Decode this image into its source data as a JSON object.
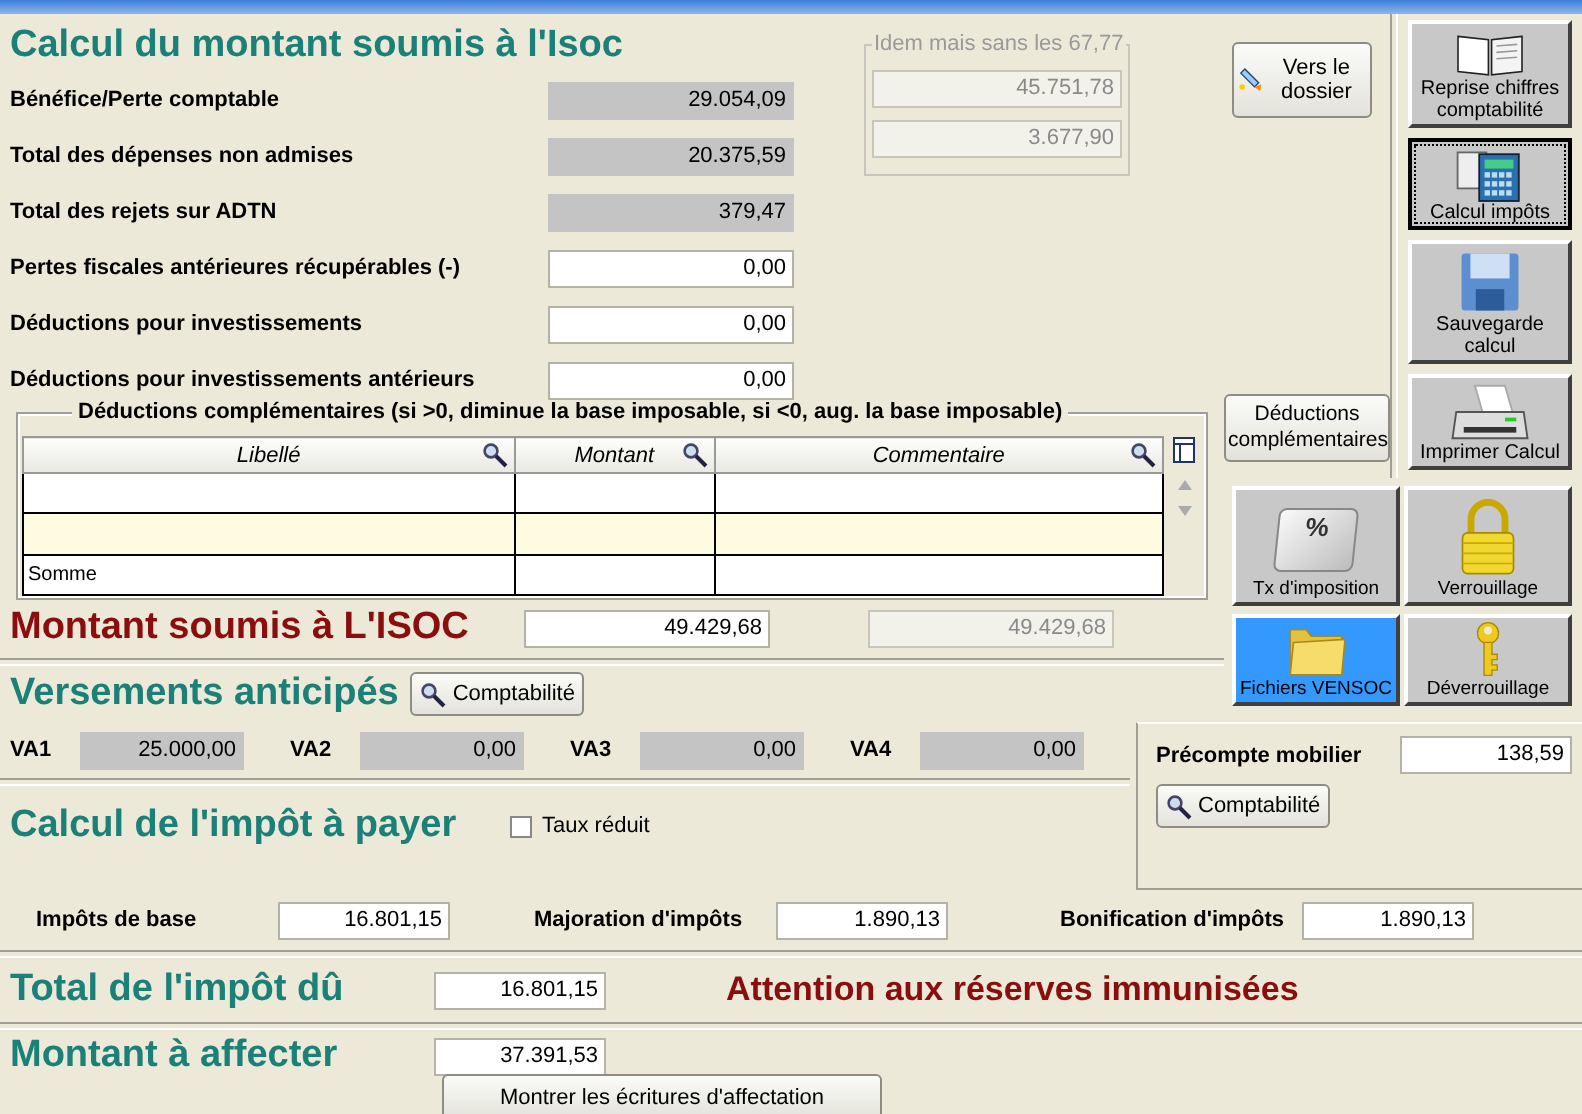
{
  "isoc_section": {
    "title": "Calcul du montant soumis à l'Isoc",
    "rows": [
      {
        "label": "Bénéfice/Perte comptable",
        "value": "29.054,09",
        "readonly": true
      },
      {
        "label": "Total des dépenses non admises",
        "value": "20.375,59",
        "readonly": true
      },
      {
        "label": "Total des rejets sur ADTN",
        "value": "379,47",
        "readonly": true
      },
      {
        "label": "Pertes fiscales antérieures récupérables (-)",
        "value": "0,00",
        "readonly": false
      },
      {
        "label": "Déductions pour investissements",
        "value": "0,00",
        "readonly": false
      },
      {
        "label": "Déductions pour investissements antérieurs",
        "value": "0,00",
        "readonly": false
      }
    ],
    "idem_group": {
      "title": "Idem mais sans les 67,77",
      "values": [
        {
          "value": "45.751,78",
          "disabled": true
        },
        {
          "value": "3.677,90",
          "disabled": true
        }
      ]
    },
    "dossier_button": "Vers le dossier",
    "deductions_button": "Déductions complémentaires",
    "deductions_table": {
      "title": "Déductions complémentaires  (si >0, diminue la base imposable, si <0, aug. la base imposable)",
      "columns": [
        "Libellé",
        "Montant",
        "Commentaire"
      ],
      "rows": [
        {
          "cells": [],
          "selected": false
        },
        {
          "cells": [],
          "selected": true
        },
        {
          "cells": [
            "Somme"
          ],
          "selected": false
        }
      ]
    },
    "total": {
      "label": "Montant soumis à L'ISOC",
      "value": {
        "value": "49.429,68",
        "disabled": false
      },
      "value_2": {
        "value": "49.429,68",
        "disabled": true
      }
    }
  },
  "tool_buttons": [
    {
      "label": "Reprise chiffres comptabilité",
      "selected": false,
      "focused": false
    },
    {
      "label": "Calcul impôts",
      "selected": false,
      "focused": true
    },
    {
      "label": "Sauvegarde calcul",
      "selected": false,
      "focused": false
    },
    {
      "label": "Imprimer Calcul",
      "selected": false,
      "focused": false
    }
  ],
  "grid_buttons": [
    {
      "label": "Tx d'imposition",
      "key_glyph": "%",
      "selected": false
    },
    {
      "label": "Verrouillage",
      "selected": false
    },
    {
      "label": "Fichiers VENSOC",
      "selected": true
    },
    {
      "label": "Déverrouillage",
      "selected": false
    }
  ],
  "versements": {
    "title": "Versements anticipés",
    "button": "Comptabilité",
    "items": [
      {
        "label": "VA1",
        "value": "25.000,00",
        "readonly": true
      },
      {
        "label": "VA2",
        "value": "0,00",
        "readonly": true
      },
      {
        "label": "VA3",
        "value": "0,00",
        "readonly": true
      },
      {
        "label": "VA4",
        "value": "0,00",
        "readonly": true
      }
    ]
  },
  "precompte": {
    "label": "Précompte mobilier",
    "value": "138,59",
    "readonly": false,
    "button": "Comptabilité"
  },
  "impot": {
    "title": "Calcul de l'impôt à payer",
    "checkbox": {
      "label": "Taux réduit",
      "checked": false
    },
    "items": [
      {
        "label": "Impôts de base",
        "value": "16.801,15",
        "readonly": false
      },
      {
        "label": "Majoration d'impôts",
        "value": "1.890,13",
        "readonly": false
      },
      {
        "label": "Bonification d'impôts",
        "value": "1.890,13",
        "readonly": false
      }
    ]
  },
  "total_du": {
    "label": "Total de l'impôt dû",
    "value": "16.801,15",
    "readonly": false,
    "warning": "Attention aux réserves immunisées"
  },
  "affecter": {
    "label": "Montant à affecter",
    "value": "37.391,53",
    "readonly": false,
    "button": "Montrer  les écritures d'affectation"
  }
}
